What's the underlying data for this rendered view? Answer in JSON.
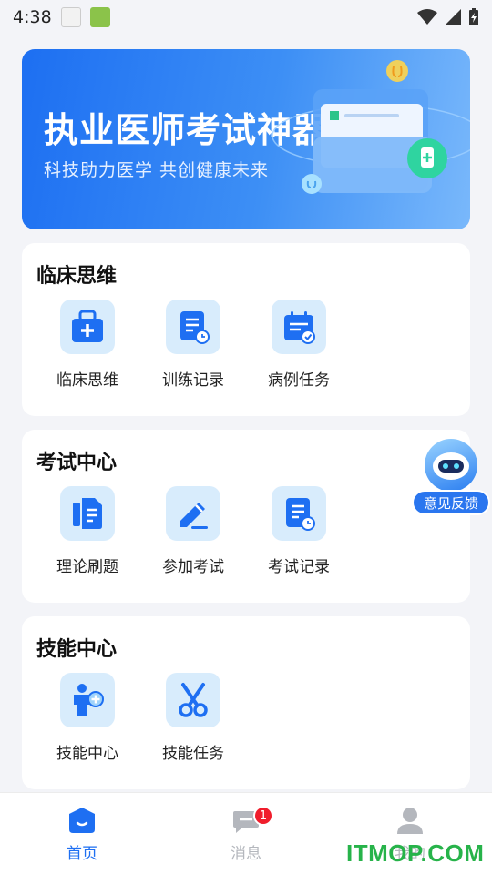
{
  "status_bar": {
    "time": "4:38"
  },
  "banner": {
    "title": "执业医师考试神器",
    "subtitle": "科技助力医学  共创健康未来"
  },
  "sections": [
    {
      "title": "临床思维",
      "items": [
        {
          "label": "临床思维",
          "icon": "medical-kit-icon"
        },
        {
          "label": "训练记录",
          "icon": "document-clock-icon"
        },
        {
          "label": "病例任务",
          "icon": "calendar-check-icon"
        }
      ]
    },
    {
      "title": "考试中心",
      "items": [
        {
          "label": "理论刷题",
          "icon": "book-icon"
        },
        {
          "label": "参加考试",
          "icon": "pencil-icon"
        },
        {
          "label": "考试记录",
          "icon": "document-clock-icon"
        }
      ]
    },
    {
      "title": "技能中心",
      "items": [
        {
          "label": "技能中心",
          "icon": "doctor-plus-icon"
        },
        {
          "label": "技能任务",
          "icon": "scissors-icon"
        }
      ]
    }
  ],
  "feedback": {
    "label": "意见反馈"
  },
  "tabs": [
    {
      "label": "首页",
      "active": true,
      "icon": "home-icon"
    },
    {
      "label": "消息",
      "active": false,
      "icon": "message-icon",
      "badge": "1"
    },
    {
      "label": "我的",
      "active": false,
      "icon": "user-icon"
    }
  ],
  "watermark": "ITMOP.COM",
  "colors": {
    "accent": "#1e6ff2",
    "tile_bg": "#d8ecfc",
    "badge": "#f01d2c",
    "page_bg": "#f3f4f8"
  }
}
